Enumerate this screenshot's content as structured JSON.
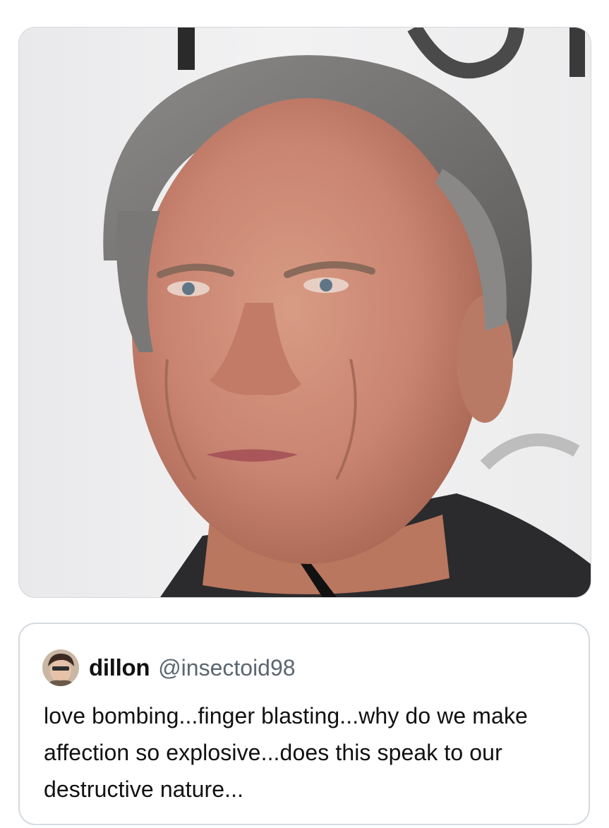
{
  "media": {
    "background_color": "#ececed"
  },
  "quoted_tweet": {
    "display_name": "dillon",
    "handle": "@insectoid98",
    "text": "love bombing...finger blasting...why do we make affection so explosive...does this speak to our destructive nature...",
    "avatar_icon": "user-avatar"
  },
  "colors": {
    "card_border": "#d5dadf",
    "handle_gray": "#5b6670",
    "text": "#111111"
  }
}
